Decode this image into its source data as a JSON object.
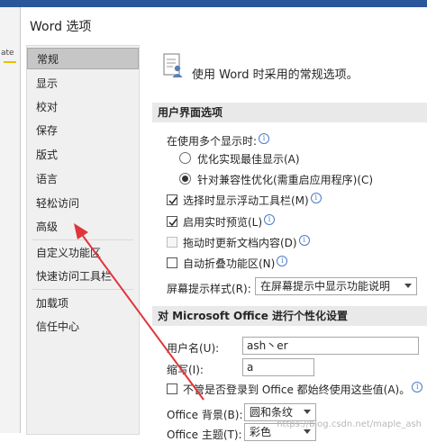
{
  "background_app": {
    "fragment": "ate"
  },
  "dialog": {
    "title": "Word 选项"
  },
  "sidebar": {
    "items": [
      {
        "label": "常规"
      },
      {
        "label": "显示"
      },
      {
        "label": "校对"
      },
      {
        "label": "保存"
      },
      {
        "label": "版式"
      },
      {
        "label": "语言"
      },
      {
        "label": "轻松访问"
      },
      {
        "label": "高级"
      },
      {
        "label": "自定义功能区"
      },
      {
        "label": "快速访问工具栏"
      },
      {
        "label": "加载项"
      },
      {
        "label": "信任中心"
      }
    ],
    "selected_index": 0
  },
  "content": {
    "header": "使用 Word 时采用的常规选项。",
    "ui_section": "用户界面选项",
    "multi_display_label": "在使用多个显示时:",
    "radio_optimize": "优化实现最佳显示(A)",
    "radio_compat": "针对兼容性优化(需重启应用程序)(C)",
    "cb_minitoolbar": "选择时显示浮动工具栏(M)",
    "cb_livepreview": "启用实时预览(L)",
    "cb_drag_update": "拖动时更新文档内容(D)",
    "cb_collapse_ribbon": "自动折叠功能区(N)",
    "screentip_label": "屏幕提示样式(R):",
    "screentip_value": "在屏幕提示中显示功能说明",
    "personalize_section": "对 Microsoft Office 进行个性化设置",
    "username_label": "用户名(U):",
    "username_value": "ash丶er",
    "initials_label": "缩写(I):",
    "initials_value": "a",
    "always_use_label": "不管是否登录到 Office 都始终使用这些值(A)。",
    "background_label": "Office 背景(B):",
    "background_value": "圆和条纹",
    "theme_label": "Office 主题(T):",
    "theme_value": "彩色"
  },
  "checkbox_states": {
    "minitoolbar": true,
    "livepreview": true,
    "drag_update": false,
    "collapse_ribbon": false,
    "always_use": false
  },
  "radio_selected": "compat",
  "watermark": "https://blog.csdn.net/maple_ash",
  "colors": {
    "annotation_arrow": "#e0353b",
    "selected_nav": "#c6c6c6",
    "section_bg": "#e9e9e9"
  }
}
